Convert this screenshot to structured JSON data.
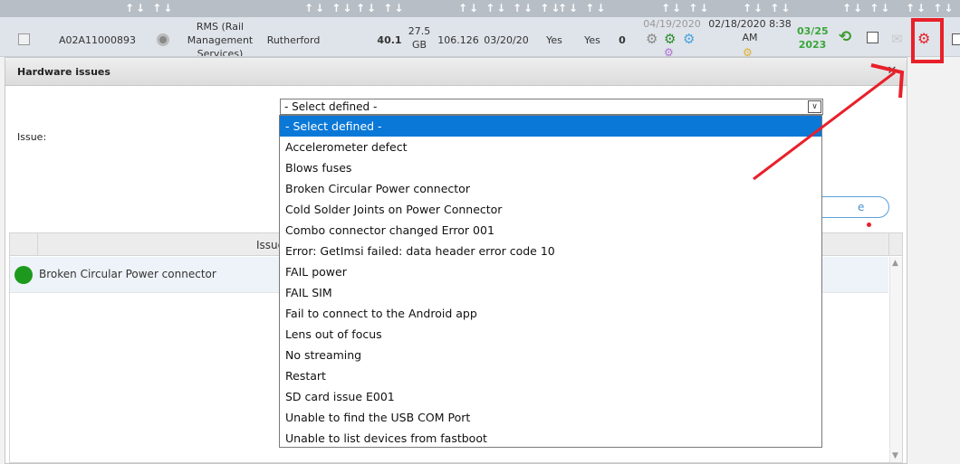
{
  "header": {
    "sort_glyph": "↑↓ ↑↓"
  },
  "row": {
    "serial": "A02A11000893",
    "company": "RMS (Rail Management Services)",
    "location": "Rutherford",
    "version": "40.1",
    "storage": "27.5 GB",
    "firmware": "106.126",
    "date1": "03/20/20",
    "flag1": "Yes",
    "flag2": "Yes",
    "count": "0",
    "date2": "04/19/2020",
    "datetime": "02/18/2020 8:38 AM",
    "expiry": "03/25 2023"
  },
  "dialog": {
    "title": "Hardware issues",
    "close_glyph": "✕",
    "issue_label": "Issue:",
    "select_value": "- Select defined -",
    "ghost_button_tail": "e",
    "table": {
      "column_header": "Issue",
      "rows": [
        {
          "text": "Broken Circular Power connector",
          "status_color": "#1d9a1d"
        }
      ]
    }
  },
  "dropdown": {
    "options": [
      "- Select defined -",
      "Accelerometer defect",
      "Blows fuses",
      "Broken Circular Power connector",
      "Cold Solder Joints on Power Connector",
      "Combo connector changed Error 001",
      "Error: GetImsi failed: data header error code 10",
      "FAIL power",
      "FAIL SIM",
      "Fail to connect to the Android app",
      "Lens out of focus",
      "No streaming",
      "Restart",
      "SD card issue E001",
      "Unable to find the USB COM Port",
      "Unable to list devices from fastboot"
    ],
    "selected_index": 0,
    "selected_color": "#0a78d7"
  },
  "annotation_color": "#e8202a"
}
